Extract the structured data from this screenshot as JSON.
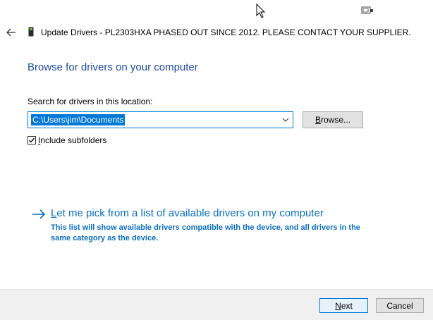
{
  "window": {
    "title": "Update Drivers - PL2303HXA PHASED OUT SINCE 2012. PLEASE CONTACT YOUR SUPPLIER."
  },
  "page": {
    "heading": "Browse for drivers on your computer",
    "search_label": "Search for drivers in this location:",
    "path_value": "C:\\Users\\jim\\Documents",
    "browse_label_accel": "B",
    "browse_label_rest": "rowse...",
    "include_subfolders_accel": "I",
    "include_subfolders_rest": "nclude subfolders",
    "include_subfolders_checked": true
  },
  "pick_option": {
    "title_accel": "L",
    "title_rest": "et me pick from a list of available drivers on my computer",
    "description": "This list will show available drivers compatible with the device, and all drivers in the same category as the device."
  },
  "footer": {
    "next_accel": "N",
    "next_rest": "ext",
    "cancel_label": "Cancel"
  },
  "colors": {
    "heading": "#1c4b9c",
    "link": "#0a6fc2",
    "selection": "#0078d7"
  },
  "icons": {
    "back": "arrow-left-icon",
    "device": "usb-device-icon",
    "dropdown": "chevron-down-icon",
    "link_arrow": "arrow-right-icon",
    "checkbox": "checkmark-icon",
    "cursor": "mouse-cursor-icon",
    "touch": "touch-keyboard-icon"
  }
}
